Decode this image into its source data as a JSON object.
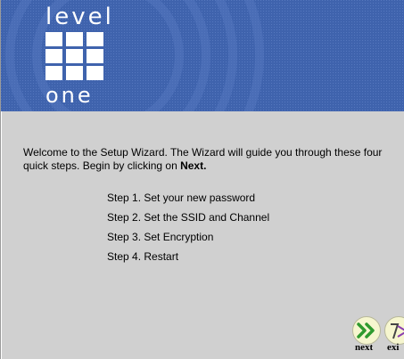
{
  "brand": {
    "line1": "level",
    "line2": "one"
  },
  "intro": {
    "text_before": "Welcome to the Setup Wizard. The Wizard will guide you through these four quick steps. Begin by clicking on ",
    "text_bold": "Next."
  },
  "steps": [
    "Step 1. Set your new password",
    "Step 2. Set the SSID and Channel",
    "Step 3. Set Encryption",
    "Step 4. Restart"
  ],
  "buttons": {
    "next_label": "next",
    "exit_label": "exi"
  },
  "icons": {
    "next": "double-chevron-right-icon",
    "exit": "exit-door-icon"
  },
  "colors": {
    "banner": "#3f63ad",
    "panel": "#d0d0d0",
    "accent": "#2e9a2e"
  }
}
